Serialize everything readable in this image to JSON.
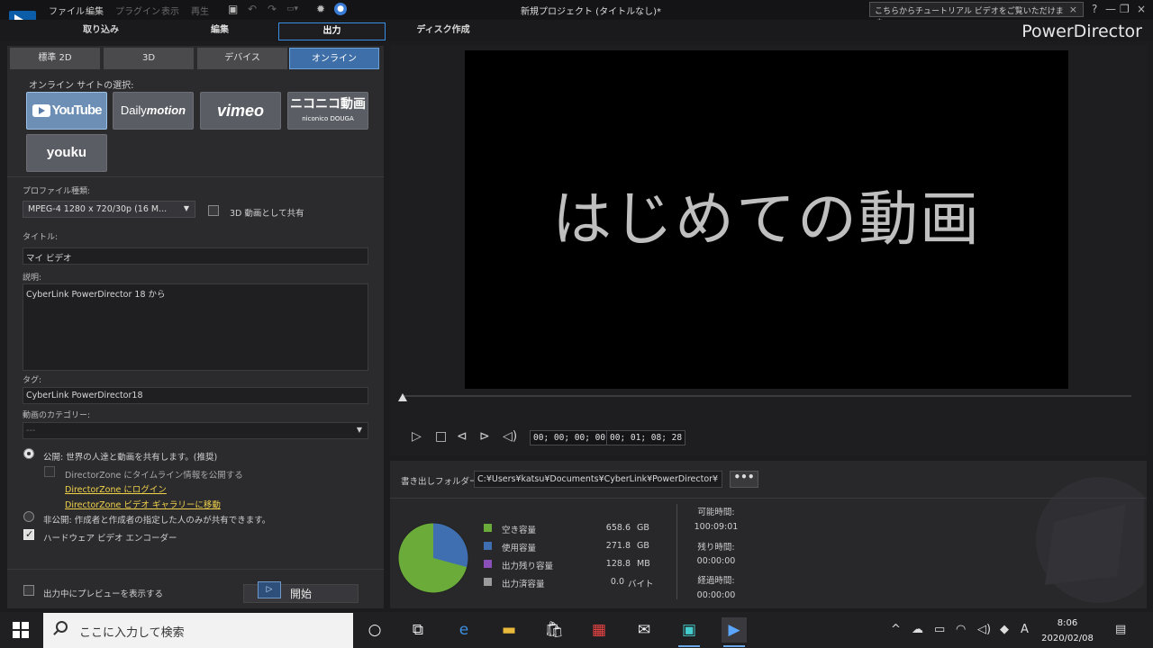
{
  "titlebar": {
    "menu": [
      "ファイル",
      "編集",
      "プラグイン",
      "表示",
      "再生"
    ],
    "project_title": "新規プロジェクト (タイトルなし)*",
    "tutorial_text": "こちらからチュートリアル ビデオをご覧いただけます。",
    "close_glyph": "×",
    "window_controls": [
      "?",
      "—",
      "❐",
      "×"
    ]
  },
  "main_tabs": [
    "取り込み",
    "編集",
    "出力",
    "ディスク作成"
  ],
  "brand": "PowerDirector",
  "sub_tabs": [
    "標準 2D",
    "3D",
    "デバイス",
    "オンライン"
  ],
  "online": {
    "heading": "オンライン サイトの選択:",
    "sites": [
      "YouTube",
      "Dailymotion",
      "vimeo",
      "ニコニコ動画",
      "youku"
    ],
    "niconico_sub": "niconico DOUGA",
    "daily_a": "Daily",
    "daily_b": "motion",
    "yt_text": "YouTube"
  },
  "form": {
    "profile_label": "プロファイル種類:",
    "profile_value": "MPEG-4 1280 x 720/30p (16 M...",
    "share3d_label": "3D 動画として共有",
    "title_label": "タイトル:",
    "title_value": "マイ ビデオ",
    "desc_label": "説明:",
    "desc_value": "CyberLink PowerDirector 18 から",
    "tag_label": "タグ:",
    "tag_value": "CyberLink PowerDirector18",
    "category_label": "動画のカテゴリー:",
    "category_value": "---",
    "public_label": "公開: 世界の人達と動画を共有します。(推奨)",
    "dz_timeline_label": "DirectorZone にタイムライン情報を公開する",
    "dz_login": "DirectorZone にログイン",
    "dz_gallery": "DirectorZone ビデオ ギャラリーに移動",
    "private_label": "非公開: 作成者と作成者の指定した人のみが共有できます。",
    "hw_encoder_label": "ハードウェア ビデオ エンコーダー",
    "preview_label": "出力中にプレビューを表示する",
    "start_label": "開始"
  },
  "preview": {
    "video_text": "はじめての動画",
    "timecode_current": "00; 00; 00; 00",
    "timecode_total": "00; 01; 08; 28"
  },
  "output": {
    "folder_label": "書き出しフォルダー:",
    "folder_path": "C:¥Users¥katsu¥Documents¥CyberLink¥PowerDirector¥",
    "browse_label": "•••",
    "legend": [
      {
        "label": "空き容量",
        "value": "658.6",
        "unit": "GB",
        "color": "#6aab3a"
      },
      {
        "label": "使用容量",
        "value": "271.8",
        "unit": "GB",
        "color": "#3f6fb0"
      },
      {
        "label": "出力残り容量",
        "value": "128.8",
        "unit": "MB",
        "color": "#8a4fb8"
      },
      {
        "label": "出力済容量",
        "value": "0.0",
        "unit": "バイト",
        "color": "#9b9b9b"
      }
    ],
    "pie_fractions": [
      0.708,
      0.292
    ],
    "time_info": [
      {
        "label": "可能時間:",
        "value": "100:09:01"
      },
      {
        "label": "残り時間:",
        "value": "00:00:00"
      },
      {
        "label": "経過時間:",
        "value": "00:00:00"
      }
    ]
  },
  "taskbar": {
    "search_placeholder": "ここに入力して検索",
    "time": "8:06",
    "date": "2020/02/08",
    "ime": "A"
  }
}
